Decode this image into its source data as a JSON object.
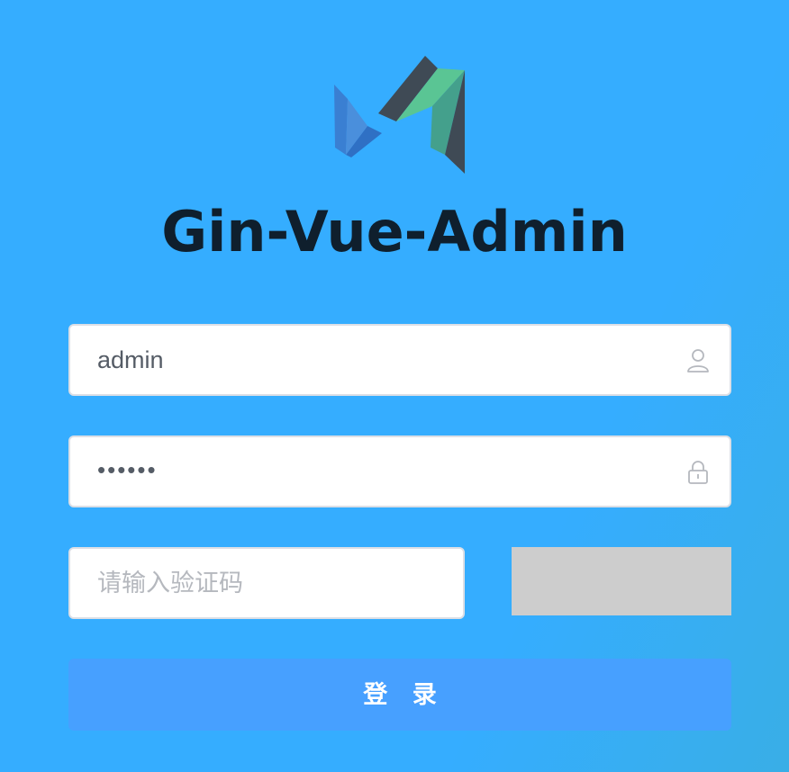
{
  "app": {
    "title": "Gin-Vue-Admin",
    "logo_icon": "gin-vue-admin-logo"
  },
  "login_form": {
    "username": {
      "value": "admin",
      "icon": "user-icon"
    },
    "password": {
      "value": "••••••",
      "icon": "lock-icon"
    },
    "captcha": {
      "value": "",
      "placeholder": "请输入验证码"
    },
    "submit_label": "登 录"
  },
  "colors": {
    "background": "#35adff",
    "title": "#0f1f2d",
    "button": "#47a0ff",
    "captcha_image": "#cdcdcd",
    "logo_blue": "#2f7fd6",
    "logo_green": "#5ac594",
    "logo_dark": "#3f4a55"
  }
}
